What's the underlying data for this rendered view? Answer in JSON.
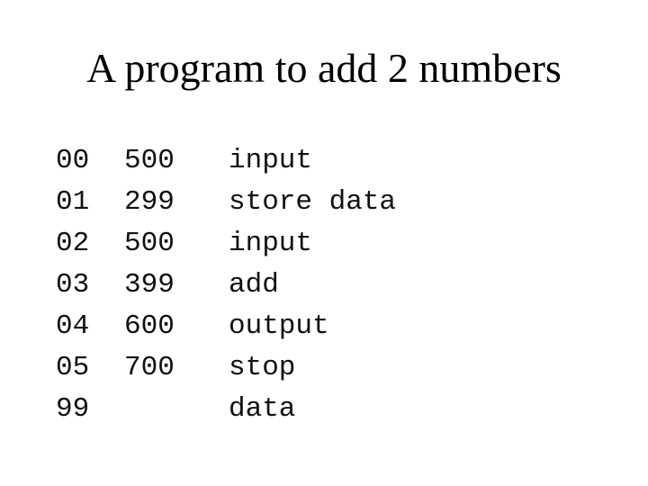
{
  "title": "A program to add 2 numbers",
  "program": {
    "rows": [
      {
        "address": "00",
        "code": "500",
        "description": "input"
      },
      {
        "address": "01",
        "code": "299",
        "description": "store data"
      },
      {
        "address": "02",
        "code": "500",
        "description": "input"
      },
      {
        "address": "03",
        "code": "399",
        "description": "add"
      },
      {
        "address": "04",
        "code": "600",
        "description": "output"
      },
      {
        "address": "05",
        "code": "700",
        "description": "stop"
      },
      {
        "address": "99",
        "code": "",
        "description": "data"
      }
    ]
  }
}
